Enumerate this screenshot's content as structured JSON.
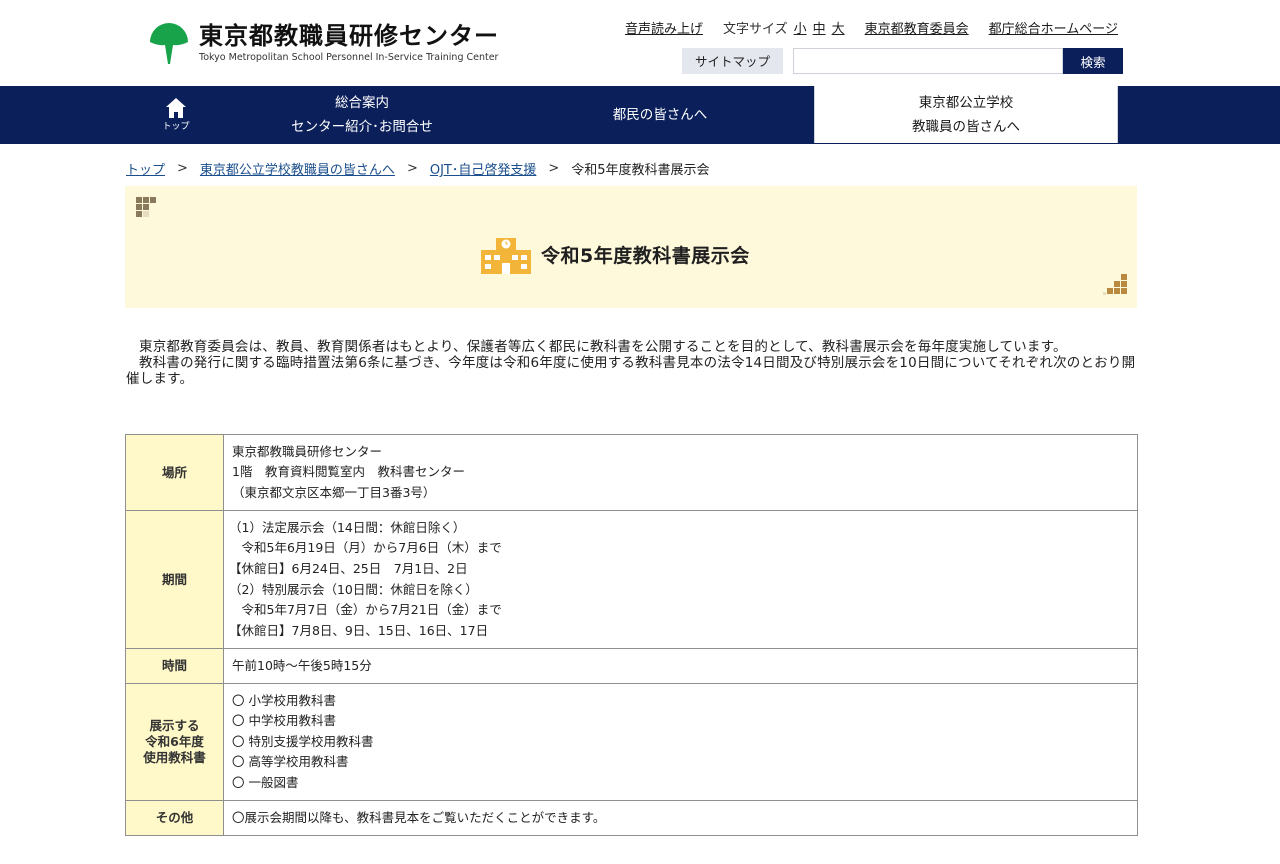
{
  "header": {
    "logo_ja": "東京都教職員研修センター",
    "logo_en": "Tokyo Metropolitan School Personnel In-Service Training Center",
    "links": {
      "read_aloud": "音声読み上げ",
      "font_size_label": "文字サイズ",
      "font_small": "小",
      "font_medium": "中",
      "font_large": "大",
      "board": "東京都教育委員会",
      "metro": "都庁総合ホームページ"
    },
    "sitemap": "サイトマップ",
    "search_button": "検索",
    "search_value": ""
  },
  "nav": {
    "home": "トップ",
    "guide_line1": "総合案内",
    "guide_line2": "センター紹介･お問合せ",
    "citizens": "都民の皆さんへ",
    "teachers_line1": "東京都公立学校",
    "teachers_line2": "教職員の皆さんへ"
  },
  "breadcrumb": {
    "top": "トップ",
    "teachers": "東京都公立学校教職員の皆さんへ",
    "ojt": "OJT･自己啓発支援",
    "current": "令和5年度教科書展示会",
    "separator": ">"
  },
  "page_title": "令和5年度教科書展示会",
  "intro": {
    "p1": "東京都教育委員会は、教員、教育関係者はもとより、保護者等広く都民に教科書を公開することを目的として、教科書展示会を毎年度実施しています。",
    "p2": "教科書の発行に関する臨時措置法第6条に基づき、今年度は令和6年度に使用する教科書見本の法令14日間及び特別展示会を10日間についてそれぞれ次のとおり開催します。"
  },
  "table": {
    "place": {
      "label": "場所",
      "lines": [
        "東京都教職員研修センター",
        "1階　教育資料閲覧室内　教科書センター",
        "（東京都文京区本郷一丁目3番3号）"
      ]
    },
    "period": {
      "label": "期間",
      "lines": [
        "（1）法定展示会（14日間：休館日除く）",
        "　令和5年6月19日（月）から7月6日（木）まで",
        "【休館日】6月24日、25日　7月1日、2日",
        "（2）特別展示会（10日間：休館日を除く）",
        "　令和5年7月7日（金）から7月21日（金）まで",
        "【休館日】7月8日、9日、15日、16日、17日"
      ]
    },
    "time": {
      "label": "時間",
      "value": "午前10時～午後5時15分"
    },
    "books": {
      "label_line1": "展示する",
      "label_line2": "令和6年度",
      "label_line3": "使用教科書",
      "items": [
        "〇 小学校用教科書",
        "〇 中学校用教科書",
        "〇 特別支援学校用教科書",
        "〇 高等学校用教科書",
        "〇 一般図書"
      ]
    },
    "other": {
      "label": "その他",
      "value": "〇展示会期間以降も、教科書見本をご覧いただくことができます。"
    }
  },
  "colors": {
    "nav_bg": "#0b1f5b",
    "title_band": "#fff9dc",
    "table_header": "#fff8c8",
    "logo_green": "#16a34a",
    "icon_gold": "#f2b53a"
  }
}
